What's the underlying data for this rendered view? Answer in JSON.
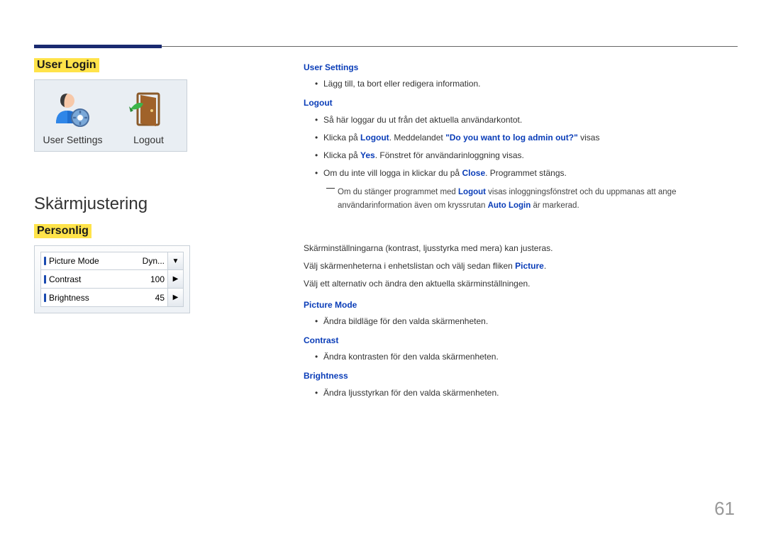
{
  "headings": {
    "user_login": "User Login",
    "skarm": "Skärmjustering",
    "personlig": "Personlig"
  },
  "login_panel": {
    "user_settings": "User Settings",
    "logout": "Logout"
  },
  "settings_panel": {
    "rows": [
      {
        "label": "Picture Mode",
        "value": "Dyn...",
        "ctrl": "▼"
      },
      {
        "label": "Contrast",
        "value": "100",
        "ctrl": "▶"
      },
      {
        "label": "Brightness",
        "value": "45",
        "ctrl": "▶"
      }
    ]
  },
  "right_top": {
    "h_user_settings": "User Settings",
    "us_li1": "Lägg till, ta bort eller redigera information.",
    "h_logout": "Logout",
    "lo_li1": "Så här loggar du ut från det aktuella användarkontot.",
    "lo_li2_a": "Klicka på ",
    "lo_li2_b": "Logout",
    "lo_li2_c": ". Meddelandet ",
    "lo_li2_d": "\"Do you want to log admin out?\"",
    "lo_li2_e": " visas",
    "lo_li3_a": "Klicka på ",
    "lo_li3_b": "Yes",
    "lo_li3_c": ". Fönstret för användarinloggning visas.",
    "lo_li4_a": "Om du inte vill logga in klickar du på ",
    "lo_li4_b": "Close",
    "lo_li4_c": ". Programmet stängs.",
    "note_a": "Om du stänger programmet med ",
    "note_b": "Logout",
    "note_c": " visas inloggningsfönstret och du uppmanas att ange användarinformation även om kryssrutan ",
    "note_d": "Auto Login",
    "note_e": " är markerad."
  },
  "right_bottom": {
    "p1": "Skärminställningarna (kontrast, ljusstyrka med mera) kan justeras.",
    "p2_a": "Välj skärmenheterna i enhetslistan och välj sedan fliken ",
    "p2_b": "Picture",
    "p2_c": ".",
    "p3": "Välj ett alternativ och ändra den aktuella skärminställningen.",
    "h_pm": "Picture Mode",
    "pm_li1": "Ändra bildläge för den valda skärmenheten.",
    "h_con": "Contrast",
    "con_li1": "Ändra kontrasten för den valda skärmenheten.",
    "h_bri": "Brightness",
    "bri_li1": "Ändra ljusstyrkan för den valda skärmenheten."
  },
  "page_number": "61"
}
